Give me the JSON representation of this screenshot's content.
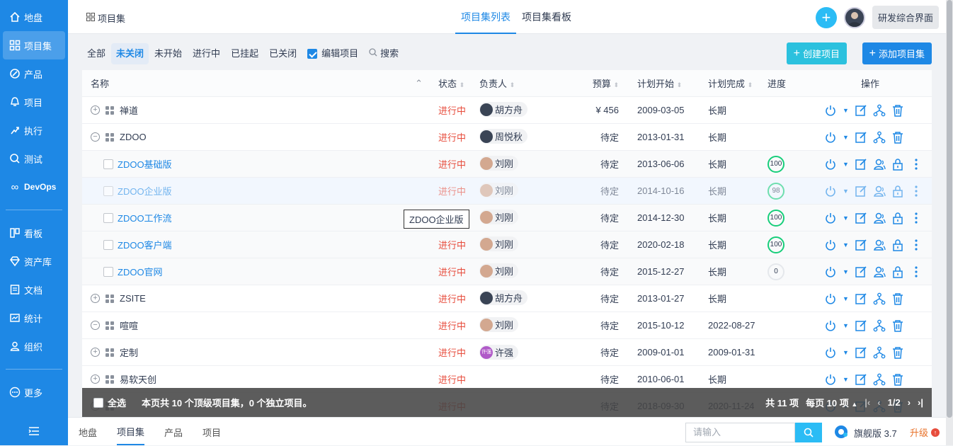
{
  "sidebar": {
    "items": [
      {
        "label": "地盘",
        "icon": "home-icon"
      },
      {
        "label": "项目集",
        "icon": "grid-icon",
        "active": true
      },
      {
        "label": "产品",
        "icon": "product-icon"
      },
      {
        "label": "项目",
        "icon": "project-icon"
      },
      {
        "label": "执行",
        "icon": "execution-icon"
      },
      {
        "label": "测试",
        "icon": "test-icon"
      },
      {
        "label": "DevOps",
        "icon": "infinity-icon"
      }
    ],
    "items2": [
      {
        "label": "看板",
        "icon": "kanban-icon"
      },
      {
        "label": "资产库",
        "icon": "diamond-icon"
      },
      {
        "label": "文档",
        "icon": "document-icon"
      },
      {
        "label": "统计",
        "icon": "chart-icon"
      },
      {
        "label": "组织",
        "icon": "user-icon"
      }
    ],
    "more": "更多"
  },
  "header": {
    "breadcrumb": "项目集",
    "tabs": [
      "项目集列表",
      "项目集看板"
    ],
    "switch_label": "研发综合界面"
  },
  "filters": {
    "items": [
      "全部",
      "未关闭",
      "未开始",
      "进行中",
      "已挂起",
      "已关闭"
    ],
    "active": "未关闭",
    "edit_project": "编辑项目",
    "search": "搜索",
    "create_project": "创建项目",
    "add_program": "添加项目集"
  },
  "table": {
    "headers": {
      "name": "名称",
      "status": "状态",
      "owner": "负责人",
      "budget": "预算",
      "start": "计划开始",
      "end": "计划完成",
      "progress": "进度",
      "actions": "操作"
    },
    "rows": [
      {
        "name": "禅道",
        "status": "进行中",
        "owner": "胡方舟",
        "budget": "¥ 456",
        "start": "2009-03-05",
        "end": "长期",
        "progress": ""
      },
      {
        "name": "ZDOO",
        "status": "进行中",
        "owner": "周悦秋",
        "budget": "待定",
        "start": "2013-01-31",
        "end": "长期",
        "progress": ""
      },
      {
        "name": "ZDOO基础版",
        "status": "进行中",
        "owner": "刘刚",
        "budget": "待定",
        "start": "2013-06-06",
        "end": "长期",
        "progress": "100"
      },
      {
        "name": "ZDOO企业版",
        "status": "进行中",
        "owner": "刘刚",
        "budget": "待定",
        "start": "2014-10-16",
        "end": "长期",
        "progress": "98"
      },
      {
        "name": "ZDOO工作流",
        "status": "进行中",
        "owner": "刘刚",
        "budget": "待定",
        "start": "2014-12-30",
        "end": "长期",
        "progress": "100"
      },
      {
        "name": "ZDOO客户端",
        "status": "进行中",
        "owner": "刘刚",
        "budget": "待定",
        "start": "2020-02-18",
        "end": "长期",
        "progress": "100"
      },
      {
        "name": "ZDOO官网",
        "status": "进行中",
        "owner": "刘刚",
        "budget": "待定",
        "start": "2015-12-27",
        "end": "长期",
        "progress": "0"
      },
      {
        "name": "ZSITE",
        "status": "进行中",
        "owner": "胡方舟",
        "budget": "待定",
        "start": "2013-01-27",
        "end": "长期",
        "progress": ""
      },
      {
        "name": "喧喧",
        "status": "进行中",
        "owner": "刘刚",
        "budget": "待定",
        "start": "2015-10-12",
        "end": "2022-08-27",
        "progress": ""
      },
      {
        "name": "定制",
        "status": "进行中",
        "owner": "许强",
        "budget": "待定",
        "start": "2009-01-01",
        "end": "2009-01-31",
        "progress": ""
      },
      {
        "name": "易软天创",
        "status": "进行中",
        "owner": "",
        "budget": "待定",
        "start": "2010-06-01",
        "end": "长期",
        "progress": ""
      },
      {
        "name": "",
        "status": "进行中",
        "owner": "",
        "budget": "待定",
        "start": "2018-09-30",
        "end": "2020-11-24",
        "progress": ""
      }
    ]
  },
  "tooltip": "ZDOO企业版",
  "footer": {
    "select_all": "全选",
    "summary": "本页共 10 个顶级项目集，0 个独立项目。",
    "total": "共 11 项",
    "per_page": "每页 10 项",
    "page": "1/2"
  },
  "bottom": {
    "nav": [
      "地盘",
      "项目集",
      "产品",
      "项目"
    ],
    "search_placeholder": "请输入",
    "edition": "旗舰版 3.7",
    "upgrade": "升级"
  },
  "colors": {
    "primary": "#1e88e5",
    "status_red": "#e74c3c",
    "progress_green": "#17ce7a"
  }
}
